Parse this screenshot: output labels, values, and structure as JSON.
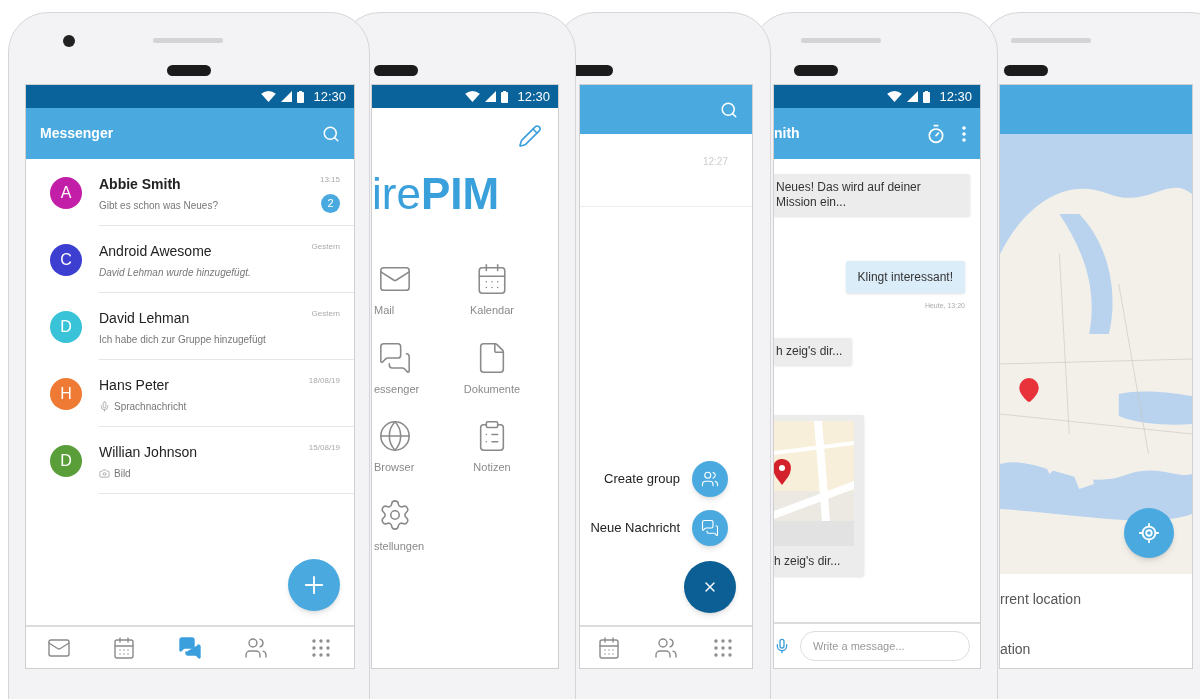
{
  "phones": [
    {
      "kind": "chat_list",
      "status_time": "12:30",
      "title": "Messenger",
      "conversations": [
        {
          "initial": "A",
          "color": "#c21ea8",
          "name": "Abbie Smith",
          "preview": "Gibt es schon was Neues?",
          "kind": "text",
          "time": "13:15",
          "unread": true,
          "unread_count": "2"
        },
        {
          "initial": "C",
          "color": "#3d3fd1",
          "name": "Android Awesome",
          "preview": "David Lehman wurde hinzugefügt.",
          "kind": "italic",
          "time": "Gestern",
          "unread": false
        },
        {
          "initial": "D",
          "color": "#38c3d8",
          "name": "David Lehman",
          "preview": "Ich habe dich zur Gruppe hinzugefügt",
          "kind": "text",
          "time": "Gestern",
          "unread": false
        },
        {
          "initial": "H",
          "color": "#ef7a33",
          "name": "Hans Peter",
          "preview": "Sprachnachricht",
          "kind": "voice",
          "time": "18/08/19",
          "unread": false
        },
        {
          "initial": "D",
          "color": "#5a9e3a",
          "name": "Willian Johnson",
          "preview": "Bild",
          "time": "15/08/19",
          "unread": false
        }
      ],
      "nav": [
        {
          "selected": false
        },
        {
          "selected": false
        },
        {
          "selected": true
        },
        {
          "selected": false
        },
        {
          "selected": false
        }
      ]
    },
    {
      "kind": "launcher",
      "status_time": "12:30",
      "logo": {
        "light": "ire",
        "bold": "PIM"
      },
      "apps": [
        {
          "label": "Mail"
        },
        {
          "label": "Kalendar"
        },
        {
          "label": "essenger"
        },
        {
          "label": "Dokumente"
        },
        {
          "label": "Browser"
        },
        {
          "label": "Notizen"
        },
        {
          "label": "stellungen"
        }
      ]
    },
    {
      "kind": "fab_menu",
      "list_time": "12:27",
      "actions": [
        {
          "label": "Create group"
        },
        {
          "label": "Neue Nachricht"
        }
      ],
      "nav": [
        {
          "selected": false
        },
        {
          "selected": false
        },
        {
          "selected": false
        }
      ]
    },
    {
      "kind": "chat",
      "status_time": "12:30",
      "contact": "nith",
      "messages": [
        {
          "kind": "incoming",
          "text": "Neues! Das wird auf deiner Mission ein..."
        },
        {
          "kind": "outgoing",
          "text": "Klingt interessant!",
          "time": "Heute, 13:20"
        },
        {
          "kind": "incoming",
          "text": "h zeig's dir..."
        },
        {
          "kind": "location",
          "text": "h zeig's dir..."
        }
      ],
      "input": {
        "placeholder": "Write a message..."
      }
    },
    {
      "kind": "map",
      "options": [
        {
          "label": "rrent location"
        },
        {
          "label": "ation"
        }
      ]
    }
  ]
}
